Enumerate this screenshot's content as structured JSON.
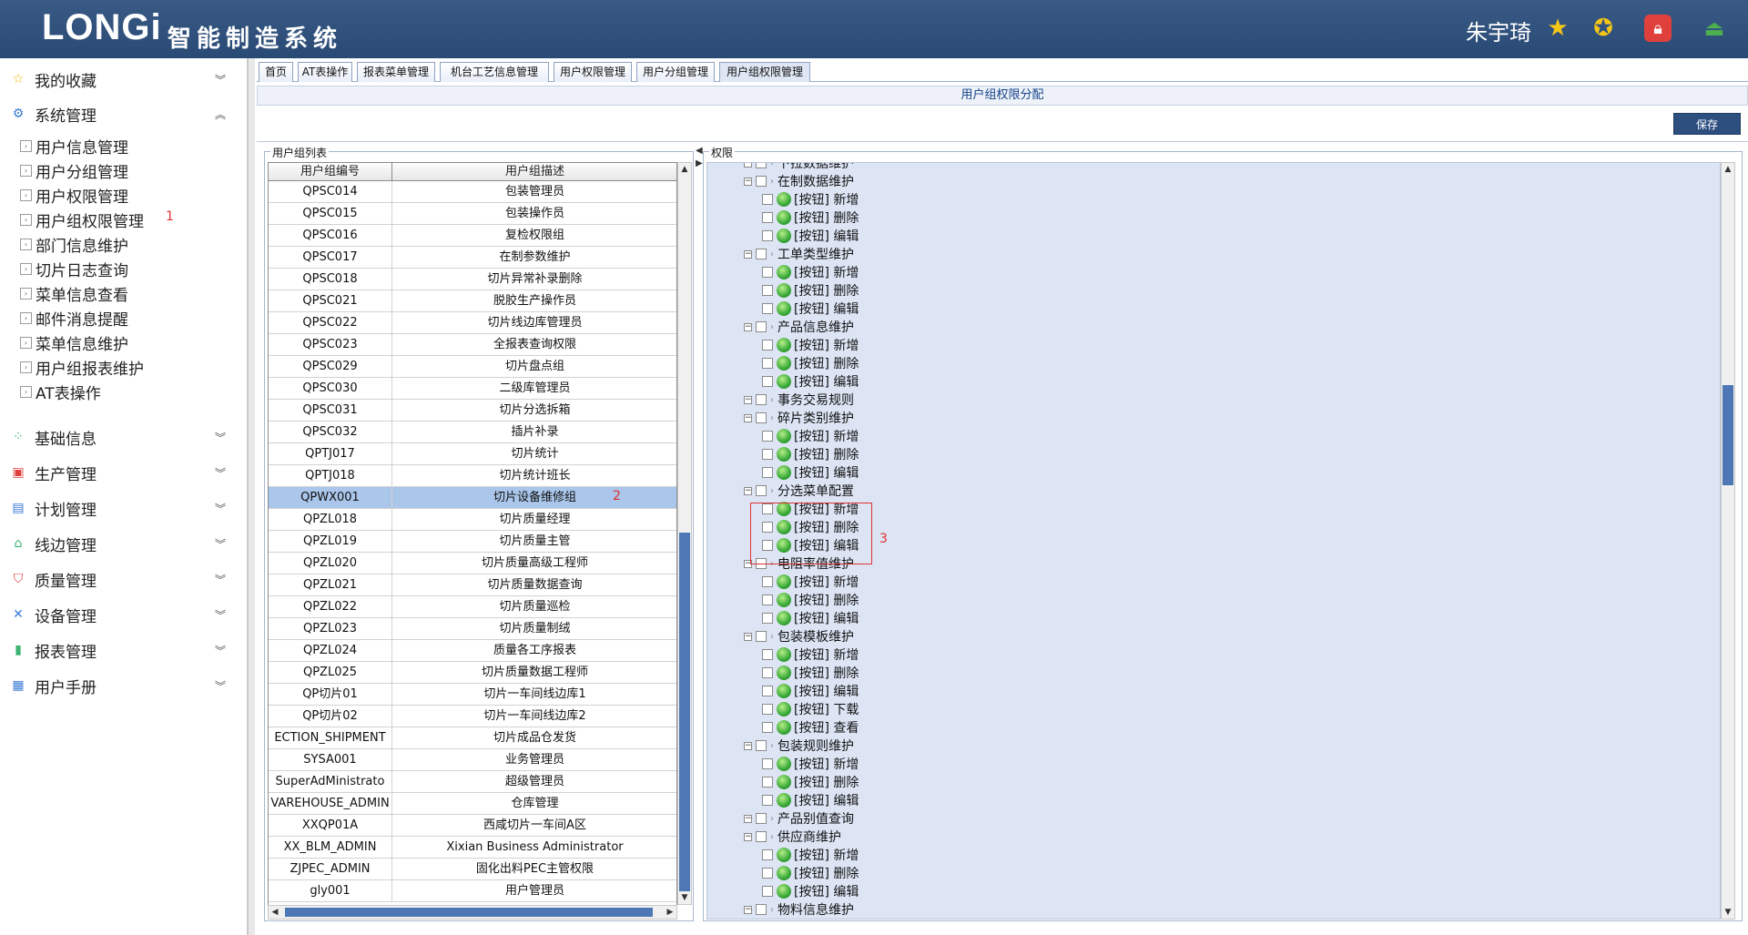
{
  "header": {
    "logo": "LONGi",
    "system_name": "智能制造系统",
    "username": "朱宇琦",
    "icons": [
      "star-icon",
      "star-outline-icon",
      "lock-icon",
      "exit-icon"
    ]
  },
  "sidebar": {
    "favorites": "我的收藏",
    "system": "系统管理",
    "system_items": [
      "用户信息管理",
      "用户分组管理",
      "用户权限管理",
      "用户组权限管理",
      "部门信息维护",
      "切片日志查询",
      "菜单信息查看",
      "邮件消息提醒",
      "菜单信息维护",
      "用户组报表维护",
      "AT表操作"
    ],
    "annotation_1": "1",
    "groups": [
      "基础信息",
      "生产管理",
      "计划管理",
      "线边管理",
      "质量管理",
      "设备管理",
      "报表管理",
      "用户手册"
    ]
  },
  "tabs": [
    "首页",
    "AT表操作",
    "报表菜单管理",
    "机台工艺信息管理",
    "用户权限管理",
    "用户分组管理",
    "用户组权限管理"
  ],
  "panel": {
    "title": "用户组权限分配",
    "save_label": "保存",
    "group_list_legend": "用户组列表",
    "perm_legend": "权限"
  },
  "grid": {
    "headers": [
      "用户组编号",
      "用户组描述"
    ],
    "rows": [
      [
        "QPSC014",
        "包装管理员"
      ],
      [
        "QPSC015",
        "包装操作员"
      ],
      [
        "QPSC016",
        "复检权限组"
      ],
      [
        "QPSC017",
        "在制参数维护"
      ],
      [
        "QPSC018",
        "切片异常补录删除"
      ],
      [
        "QPSC021",
        "脱胶生产操作员"
      ],
      [
        "QPSC022",
        "切片线边库管理员"
      ],
      [
        "QPSC023",
        "全报表查询权限"
      ],
      [
        "QPSC029",
        "切片盘点组"
      ],
      [
        "QPSC030",
        "二级库管理员"
      ],
      [
        "QPSC031",
        "切片分选拆箱"
      ],
      [
        "QPSC032",
        "插片补录"
      ],
      [
        "QPTJ017",
        "切片统计"
      ],
      [
        "QPTJ018",
        "切片统计班长"
      ],
      [
        "QPWX001",
        "切片设备维修组"
      ],
      [
        "QPZL018",
        "切片质量经理"
      ],
      [
        "QPZL019",
        "切片质量主管"
      ],
      [
        "QPZL020",
        "切片质量高级工程师"
      ],
      [
        "QPZL021",
        "切片质量数据查询"
      ],
      [
        "QPZL022",
        "切片质量巡检"
      ],
      [
        "QPZL023",
        "切片质量制绒"
      ],
      [
        "QPZL024",
        "质量各工序报表"
      ],
      [
        "QPZL025",
        "切片质量数据工程师"
      ],
      [
        "QP切片01",
        "切片一车间线边库1"
      ],
      [
        "QP切片02",
        "切片一车间线边库2"
      ],
      [
        "ECTION_SHIPMENT",
        "切片成品仓发货"
      ],
      [
        "SYSA001",
        "业务管理员"
      ],
      [
        "SuperAdMinistrato",
        "超级管理员"
      ],
      [
        "VAREHOUSE_ADMIN",
        "仓库管理"
      ],
      [
        "XXQP01A",
        "西咸切片一车间A区"
      ],
      [
        "XX_BLM_ADMIN",
        "Xixian Business Administrator"
      ],
      [
        "ZJPEC_ADMIN",
        "固化出料PEC主管权限"
      ],
      [
        "gly001",
        "用户管理员"
      ]
    ],
    "selected_index": 14,
    "annotation_2": "2"
  },
  "tree": {
    "nodes": [
      {
        "level": 0,
        "label": "下拉数据维护",
        "leaf": false
      },
      {
        "level": 0,
        "label": "在制数据维护",
        "leaf": false
      },
      {
        "level": 1,
        "label": "[按钮] 新增",
        "leaf": true
      },
      {
        "level": 1,
        "label": "[按钮] 删除",
        "leaf": true
      },
      {
        "level": 1,
        "label": "[按钮] 编辑",
        "leaf": true
      },
      {
        "level": 0,
        "label": "工单类型维护",
        "leaf": false
      },
      {
        "level": 1,
        "label": "[按钮] 新增",
        "leaf": true
      },
      {
        "level": 1,
        "label": "[按钮] 删除",
        "leaf": true
      },
      {
        "level": 1,
        "label": "[按钮] 编辑",
        "leaf": true
      },
      {
        "level": 0,
        "label": "产品信息维护",
        "leaf": false
      },
      {
        "level": 1,
        "label": "[按钮] 新增",
        "leaf": true
      },
      {
        "level": 1,
        "label": "[按钮] 删除",
        "leaf": true
      },
      {
        "level": 1,
        "label": "[按钮] 编辑",
        "leaf": true
      },
      {
        "level": 0,
        "label": "事务交易规则",
        "leaf": false
      },
      {
        "level": 0,
        "label": "碎片类别维护",
        "leaf": false
      },
      {
        "level": 1,
        "label": "[按钮] 新增",
        "leaf": true
      },
      {
        "level": 1,
        "label": "[按钮] 删除",
        "leaf": true
      },
      {
        "level": 1,
        "label": "[按钮] 编辑",
        "leaf": true
      },
      {
        "level": 0,
        "label": "分选菜单配置",
        "leaf": false
      },
      {
        "level": 1,
        "label": "[按钮] 新增",
        "leaf": true
      },
      {
        "level": 1,
        "label": "[按钮] 删除",
        "leaf": true
      },
      {
        "level": 1,
        "label": "[按钮] 编辑",
        "leaf": true
      },
      {
        "level": 0,
        "label": "电阻率值维护",
        "leaf": false
      },
      {
        "level": 1,
        "label": "[按钮] 新增",
        "leaf": true
      },
      {
        "level": 1,
        "label": "[按钮] 删除",
        "leaf": true
      },
      {
        "level": 1,
        "label": "[按钮] 编辑",
        "leaf": true
      },
      {
        "level": 0,
        "label": "包装模板维护",
        "leaf": false
      },
      {
        "level": 1,
        "label": "[按钮] 新增",
        "leaf": true
      },
      {
        "level": 1,
        "label": "[按钮] 删除",
        "leaf": true
      },
      {
        "level": 1,
        "label": "[按钮] 编辑",
        "leaf": true
      },
      {
        "level": 1,
        "label": "[按钮] 下载",
        "leaf": true
      },
      {
        "level": 1,
        "label": "[按钮] 查看",
        "leaf": true
      },
      {
        "level": 0,
        "label": "包装规则维护",
        "leaf": false
      },
      {
        "level": 1,
        "label": "[按钮] 新增",
        "leaf": true
      },
      {
        "level": 1,
        "label": "[按钮] 删除",
        "leaf": true
      },
      {
        "level": 1,
        "label": "[按钮] 编辑",
        "leaf": true
      },
      {
        "level": 0,
        "label": "产品别值查询",
        "leaf": false
      },
      {
        "level": 0,
        "label": "供应商维护",
        "leaf": false
      },
      {
        "level": 1,
        "label": "[按钮] 新增",
        "leaf": true
      },
      {
        "level": 1,
        "label": "[按钮] 删除",
        "leaf": true
      },
      {
        "level": 1,
        "label": "[按钮] 编辑",
        "leaf": true
      },
      {
        "level": 0,
        "label": "物料信息维护",
        "leaf": false
      }
    ],
    "annotation_3": "3"
  },
  "colors": {
    "header_bg": "#2f4f7c",
    "selected_row": "#aac6ea",
    "tree_bg": "#dde5f5",
    "annotation": "#e03030"
  }
}
